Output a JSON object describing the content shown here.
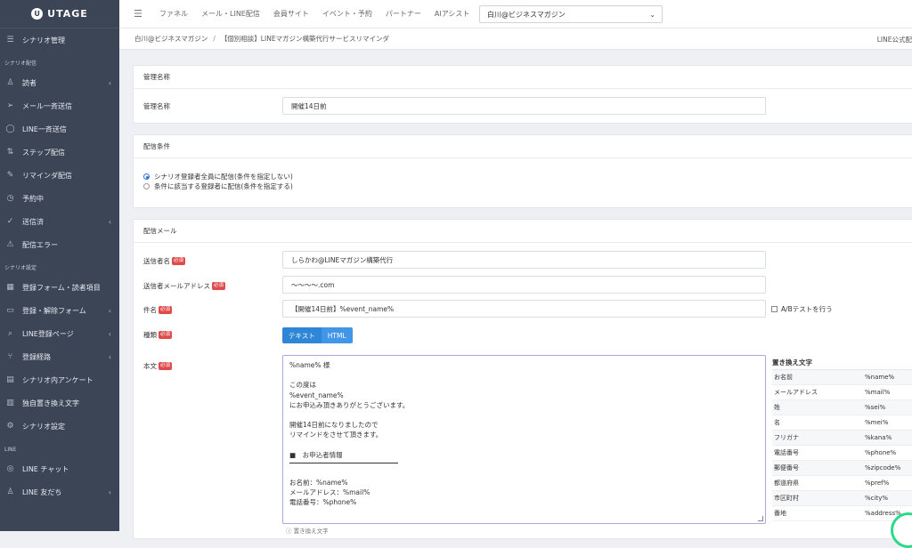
{
  "sidebar": {
    "logo": "UTAGE",
    "logo_mark": "U",
    "top_item": "シナリオ管理",
    "sections": [
      {
        "title": "シナリオ配信",
        "items": [
          {
            "label": "読者",
            "icon": "users-icon",
            "chevron": true
          },
          {
            "label": "メール一斉送信",
            "icon": "send-icon",
            "chevron": false
          },
          {
            "label": "LINE一斉送信",
            "icon": "chat-icon",
            "chevron": false
          },
          {
            "label": "ステップ配信",
            "icon": "steps-icon",
            "chevron": false
          },
          {
            "label": "リマインダ配信",
            "icon": "pencil-icon",
            "chevron": false
          },
          {
            "label": "予約中",
            "icon": "clock-icon",
            "chevron": false
          },
          {
            "label": "送信済",
            "icon": "check-icon",
            "chevron": true
          },
          {
            "label": "配信エラー",
            "icon": "warning-icon",
            "chevron": false
          }
        ]
      },
      {
        "title": "シナリオ設定",
        "items": [
          {
            "label": "登録フォーム・読者項目",
            "icon": "table-icon",
            "chevron": false
          },
          {
            "label": "登録・解除フォーム",
            "icon": "form-icon",
            "chevron": true
          },
          {
            "label": "LINE登録ページ",
            "icon": "search-icon",
            "chevron": true
          },
          {
            "label": "登録経路",
            "icon": "route-icon",
            "chevron": true
          },
          {
            "label": "シナリオ内アンケート",
            "icon": "survey-icon",
            "chevron": false
          },
          {
            "label": "独自置き換え文字",
            "icon": "doc-icon",
            "chevron": false
          },
          {
            "label": "シナリオ設定",
            "icon": "gear-icon",
            "chevron": false
          }
        ]
      },
      {
        "title": "LINE",
        "items": [
          {
            "label": "LINE チャット",
            "icon": "chat-bubbles-icon",
            "chevron": false
          },
          {
            "label": "LINE 友だち",
            "icon": "user-icon",
            "chevron": true
          }
        ]
      }
    ]
  },
  "topnav": {
    "links": [
      "ファネル",
      "メール・LINE配信",
      "会員サイト",
      "イベント・予約",
      "パートナー",
      "AIアシスト"
    ],
    "account_select": "白川@ビジネスマガジン"
  },
  "breadcrumb": {
    "items": [
      "白川@ビジネスマガジン",
      "【個別相談】LINEマガジン構築代行サービスリマインダ"
    ],
    "separator": "/",
    "right_link": "LINE公式配"
  },
  "management": {
    "header": "管理名称",
    "label": "管理名称",
    "value": "開催14日前"
  },
  "conditions": {
    "header": "配信条件",
    "options": [
      {
        "label": "シナリオ登録者全員に配信(条件を指定しない)",
        "selected": true
      },
      {
        "label": "条件に該当する登録者に配信(条件を指定する)",
        "selected": false
      }
    ]
  },
  "mail": {
    "header": "配信メール",
    "required_badge": "必須",
    "sender_name_label": "送信者名",
    "sender_name_value": "しらかわ@LINEマガジン構築代行",
    "sender_email_label": "送信者メールアドレス",
    "sender_email_value": "〜〜〜〜.com",
    "subject_label": "件名",
    "subject_value": "【開催14日前】%event_name%",
    "ab_test_label": "A/Bテストを行う",
    "type_label": "種類",
    "type_options": [
      "テキスト",
      "HTML"
    ],
    "body_label": "本文",
    "body_lines_1": [
      "%name% 様",
      "",
      "この度は",
      "%event_name%",
      "にお申込み頂きありがとうございます。",
      "",
      "開催14日前になりましたので",
      "リマインドをさせて頂きます。",
      "",
      "■　お申込者情報"
    ],
    "body_lines_2": [
      "お名前：%name%",
      "メールアドレス：%mail%",
      "電話番号：%phone%"
    ],
    "hint": "ⓘ 置き換え文字"
  },
  "replacements": {
    "title": "置き換え文字",
    "rows": [
      {
        "name": "お名前",
        "code": "%name%"
      },
      {
        "name": "メールアドレス",
        "code": "%mail%"
      },
      {
        "name": "姓",
        "code": "%sei%"
      },
      {
        "name": "名",
        "code": "%mei%"
      },
      {
        "name": "フリガナ",
        "code": "%kana%"
      },
      {
        "name": "電話番号",
        "code": "%phone%"
      },
      {
        "name": "郵便番号",
        "code": "%zipcode%"
      },
      {
        "name": "都道府県",
        "code": "%pref%"
      },
      {
        "name": "市区町村",
        "code": "%city%"
      },
      {
        "name": "番地",
        "code": "%address%"
      }
    ]
  }
}
